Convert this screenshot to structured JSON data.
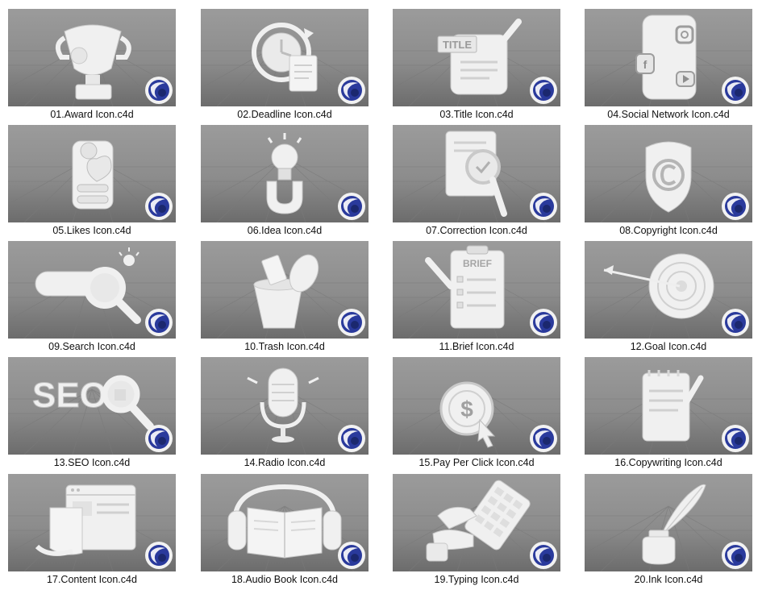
{
  "files": [
    {
      "label": "01.Award Icon.c4d",
      "icon": "award-icon"
    },
    {
      "label": "02.Deadline Icon.c4d",
      "icon": "deadline-icon"
    },
    {
      "label": "03.Title Icon.c4d",
      "icon": "title-icon",
      "text": "TITLE"
    },
    {
      "label": "04.Social Network Icon.c4d",
      "icon": "social-network-icon"
    },
    {
      "label": "05.Likes Icon.c4d",
      "icon": "likes-icon"
    },
    {
      "label": "06.Idea Icon.c4d",
      "icon": "idea-icon"
    },
    {
      "label": "07.Correction Icon.c4d",
      "icon": "correction-icon"
    },
    {
      "label": "08.Copyright Icon.c4d",
      "icon": "copyright-icon"
    },
    {
      "label": "09.Search Icon.c4d",
      "icon": "search-icon"
    },
    {
      "label": "10.Trash Icon.c4d",
      "icon": "trash-icon"
    },
    {
      "label": "11.Brief Icon.c4d",
      "icon": "brief-icon",
      "text": "BRIEF"
    },
    {
      "label": "12.Goal Icon.c4d",
      "icon": "goal-icon"
    },
    {
      "label": "13.SEO Icon.c4d",
      "icon": "seo-icon",
      "text": "SEO"
    },
    {
      "label": "14.Radio Icon.c4d",
      "icon": "radio-icon"
    },
    {
      "label": "15.Pay Per Click Icon.c4d",
      "icon": "pay-per-click-icon"
    },
    {
      "label": "16.Copywriting Icon.c4d",
      "icon": "copywriting-icon"
    },
    {
      "label": "17.Content Icon.c4d",
      "icon": "content-icon"
    },
    {
      "label": "18.Audio Book Icon.c4d",
      "icon": "audio-book-icon"
    },
    {
      "label": "19.Typing Icon.c4d",
      "icon": "typing-icon"
    },
    {
      "label": "20.Ink Icon.c4d",
      "icon": "ink-icon"
    }
  ],
  "colors": {
    "viewport_bg": "#8a8a8a",
    "floor_dark": "#5f5f5f",
    "model": "#f0f0f0",
    "model_shade": "#c9c9c9",
    "c4d_logo": "#2a3a9c",
    "label_text": "#111111"
  }
}
